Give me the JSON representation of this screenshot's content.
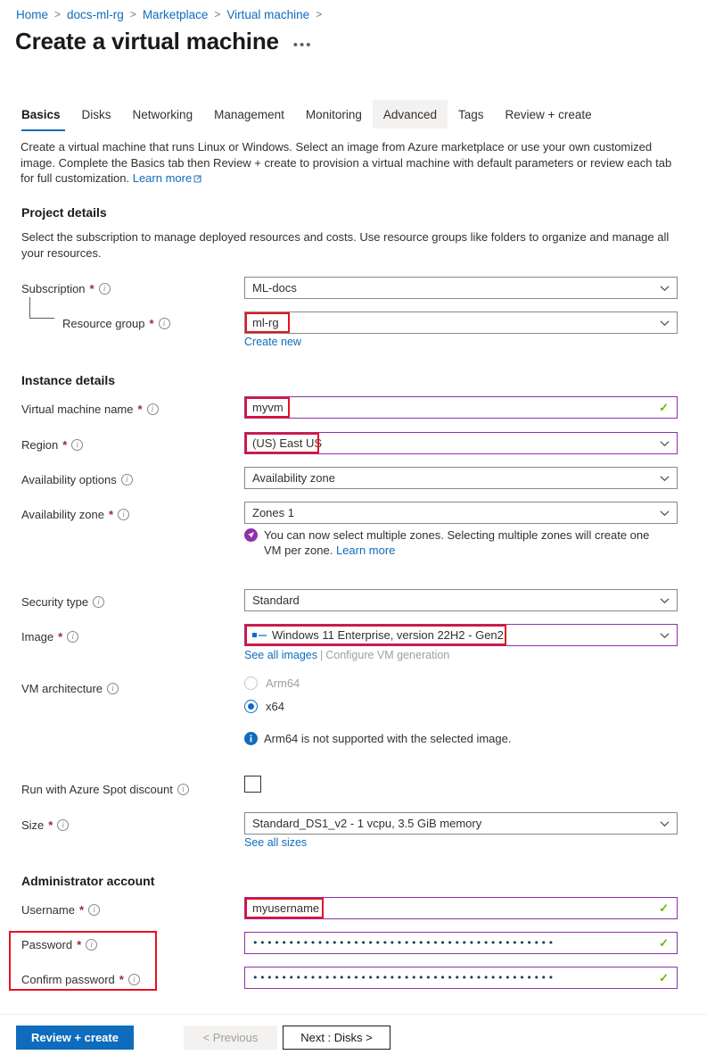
{
  "breadcrumb": {
    "items": [
      {
        "label": "Home"
      },
      {
        "label": "docs-ml-rg"
      },
      {
        "label": "Marketplace"
      },
      {
        "label": "Virtual machine"
      }
    ],
    "separator": ">"
  },
  "header": {
    "title": "Create a virtual machine",
    "overflow_label": "•••"
  },
  "tabs": [
    {
      "label": "Basics",
      "state": "active"
    },
    {
      "label": "Disks",
      "state": "normal"
    },
    {
      "label": "Networking",
      "state": "normal"
    },
    {
      "label": "Management",
      "state": "normal"
    },
    {
      "label": "Monitoring",
      "state": "normal"
    },
    {
      "label": "Advanced",
      "state": "hovered"
    },
    {
      "label": "Tags",
      "state": "normal"
    },
    {
      "label": "Review + create",
      "state": "normal"
    }
  ],
  "intro": {
    "text": "Create a virtual machine that runs Linux or Windows. Select an image from Azure marketplace or use your own customized image. Complete the Basics tab then Review + create to provision a virtual machine with default parameters or review each tab for full customization. ",
    "link_label": "Learn more"
  },
  "project_details": {
    "title": "Project details",
    "description": "Select the subscription to manage deployed resources and costs. Use resource groups like folders to organize and manage all your resources.",
    "subscription": {
      "label": "Subscription",
      "required": "*",
      "value": "ML-docs"
    },
    "resource_group": {
      "label": "Resource group",
      "required": "*",
      "value": "ml-rg",
      "create_new_label": "Create new"
    }
  },
  "instance_details": {
    "title": "Instance details",
    "vm_name": {
      "label": "Virtual machine name",
      "required": "*",
      "value": "myvm"
    },
    "region": {
      "label": "Region",
      "required": "*",
      "value": "(US) East US"
    },
    "availability_options": {
      "label": "Availability options",
      "value": "Availability zone"
    },
    "availability_zone": {
      "label": "Availability zone",
      "required": "*",
      "value": "Zones 1"
    },
    "zone_message": {
      "text": "You can now select multiple zones. Selecting multiple zones will create one VM per zone. ",
      "link_label": "Learn more",
      "icon": "rocket-icon",
      "icon_color": "#8f31a8"
    },
    "security_type": {
      "label": "Security type",
      "value": "Standard"
    },
    "image": {
      "label": "Image",
      "required": "*",
      "value": "Windows 11 Enterprise, version 22H2 - Gen2",
      "see_all_label": "See all images",
      "separator": "|",
      "configure_label": "Configure VM generation"
    },
    "vm_architecture": {
      "label": "VM architecture",
      "options": [
        {
          "label": "Arm64",
          "selected": false,
          "disabled": true
        },
        {
          "label": "x64",
          "selected": true,
          "disabled": false
        }
      ],
      "info_message": "Arm64 is not supported with the selected image.",
      "info_icon": "info-filled-icon",
      "info_color": "#0f6cbd"
    },
    "spot_discount": {
      "label": "Run with Azure Spot discount",
      "checked": false
    },
    "size": {
      "label": "Size",
      "required": "*",
      "value": "Standard_DS1_v2 - 1 vcpu, 3.5 GiB memory",
      "see_all_label": "See all sizes"
    }
  },
  "administrator_account": {
    "title": "Administrator account",
    "username": {
      "label": "Username",
      "required": "*",
      "value": "myusername"
    },
    "password": {
      "label": "Password",
      "required": "*",
      "value": "••••••••••••••••••••••••••••••••••••••••••"
    },
    "confirm_password": {
      "label": "Confirm password",
      "required": "*",
      "value": "••••••••••••••••••••••••••••••••••••••••••"
    }
  },
  "footer": {
    "review_create_label": "Review + create",
    "previous_label": "< Previous",
    "next_label": "Next : Disks >"
  },
  "colors": {
    "accent": "#0f6cbd",
    "link": "#0f6cbd",
    "required": "#a4262c",
    "validated_border": "#8f31a8",
    "valid_check": "#6bb700",
    "annotation": "#e81123"
  }
}
